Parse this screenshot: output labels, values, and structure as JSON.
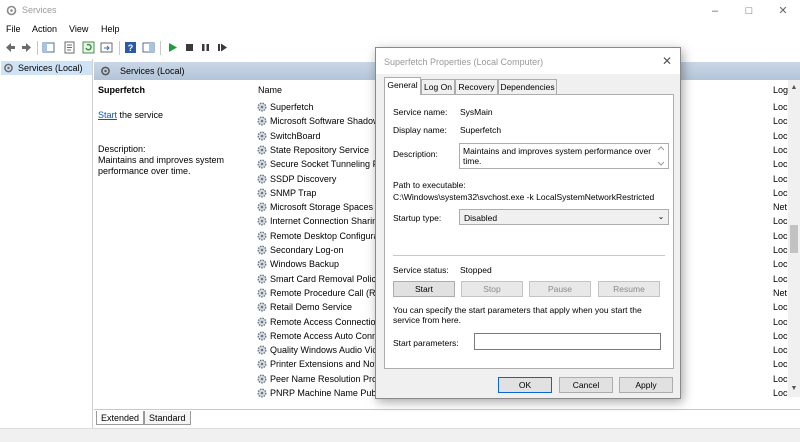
{
  "window": {
    "title": "Services"
  },
  "menu": [
    "File",
    "Action",
    "View",
    "Help"
  ],
  "tree": {
    "item": "Services (Local)"
  },
  "panel": {
    "header": "Services (Local)"
  },
  "details": {
    "service_title": "Superfetch",
    "start_link": "Start",
    "start_suffix": " the service",
    "description_label": "Description:",
    "description": "Maintains and improves system performance over time."
  },
  "list": {
    "col_name": "Name",
    "col_log": "Log",
    "rows": [
      {
        "name": "Superfetch",
        "log": "Loc"
      },
      {
        "name": "Microsoft Software Shadow",
        "log": "Loc"
      },
      {
        "name": "SwitchBoard",
        "log": "Loc"
      },
      {
        "name": "State Repository Service",
        "log": "Loc"
      },
      {
        "name": "Secure Socket Tunneling Pr",
        "log": "Loc"
      },
      {
        "name": "SSDP Discovery",
        "log": "Loc"
      },
      {
        "name": "SNMP Trap",
        "log": "Loc"
      },
      {
        "name": "Microsoft Storage Spaces S",
        "log": "Net"
      },
      {
        "name": "Internet Connection Sharin",
        "log": "Loc"
      },
      {
        "name": "Remote Desktop Configura",
        "log": "Loc"
      },
      {
        "name": "Secondary Log-on",
        "log": "Loc"
      },
      {
        "name": "Windows Backup",
        "log": "Loc"
      },
      {
        "name": "Smart Card Removal Policy",
        "log": "Loc"
      },
      {
        "name": "Remote Procedure Call (RP",
        "log": "Net"
      },
      {
        "name": "Retail Demo Service",
        "log": "Loc"
      },
      {
        "name": "Remote Access Connection",
        "log": "Loc"
      },
      {
        "name": "Remote Access Auto Conn",
        "log": "Loc"
      },
      {
        "name": "Quality Windows Audio Vic",
        "log": "Loc"
      },
      {
        "name": "Printer Extensions and Noti",
        "log": "Loc"
      },
      {
        "name": "Peer Name Resolution Prot",
        "log": "Loc"
      },
      {
        "name": "PNRP Machine Name Publ",
        "log": "Loc"
      }
    ]
  },
  "bottom_tabs": [
    "Extended",
    "Standard"
  ],
  "dialog": {
    "title": "Superfetch Properties (Local Computer)",
    "tabs": [
      "General",
      "Log On",
      "Recovery",
      "Dependencies"
    ],
    "service_name_label": "Service name:",
    "service_name": "SysMain",
    "display_name_label": "Display name:",
    "display_name": "Superfetch",
    "description_label": "Description:",
    "description": "Maintains and improves system performance over time.",
    "path_label": "Path to executable:",
    "path": "C:\\Windows\\system32\\svchost.exe -k LocalSystemNetworkRestricted",
    "startup_label": "Startup type:",
    "startup_value": "Disabled",
    "status_label": "Service status:",
    "status_value": "Stopped",
    "btn_start": "Start",
    "btn_stop": "Stop",
    "btn_pause": "Pause",
    "btn_resume": "Resume",
    "hint": "You can specify the start parameters that apply when you start the service from here.",
    "params_label": "Start parameters:",
    "params_value": "",
    "ok": "OK",
    "cancel": "Cancel",
    "apply": "Apply"
  },
  "colors": {
    "selection": "#cfe3f7",
    "link": "#0a56b4",
    "header_gradient_top": "#c9d6e6",
    "play_green": "#1f9d3a"
  },
  "icons": [
    "services-icon",
    "back-arrow-icon",
    "forward-arrow-icon",
    "console-tree-icon",
    "properties-icon",
    "refresh-icon",
    "export-icon",
    "help-icon",
    "show-hide-icon",
    "play-icon",
    "stop-icon",
    "pause-icon",
    "restart-icon",
    "gear-icon",
    "close-icon",
    "minimize-icon",
    "maximize-icon",
    "chevron-down-icon"
  ]
}
